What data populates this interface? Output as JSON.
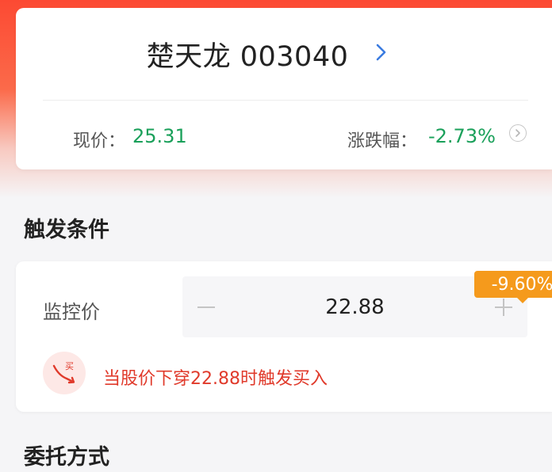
{
  "stock": {
    "title": "楚天龙 003040",
    "price_label": "现价：",
    "price_value": "25.31",
    "change_label": "涨跌幅：",
    "change_value": "-2.73%"
  },
  "condition": {
    "section_title": "触发条件",
    "monitor_label": "监控价",
    "monitor_value": "22.88",
    "pct_badge": "-9.60%",
    "trigger_icon_text": "买",
    "trigger_text": "当股价下穿22.88时触发买入"
  },
  "order": {
    "section_title": "委托方式"
  },
  "colors": {
    "header_red": "#fc4a33",
    "down_green": "#1aa05a",
    "badge_orange": "#f59a1c",
    "alert_red": "#e03a2b",
    "link_blue": "#3a7be0"
  },
  "icons": [
    "chevron-right-icon",
    "info-circle-icon",
    "minus-icon",
    "plus-icon",
    "price-down-buy-icon"
  ]
}
